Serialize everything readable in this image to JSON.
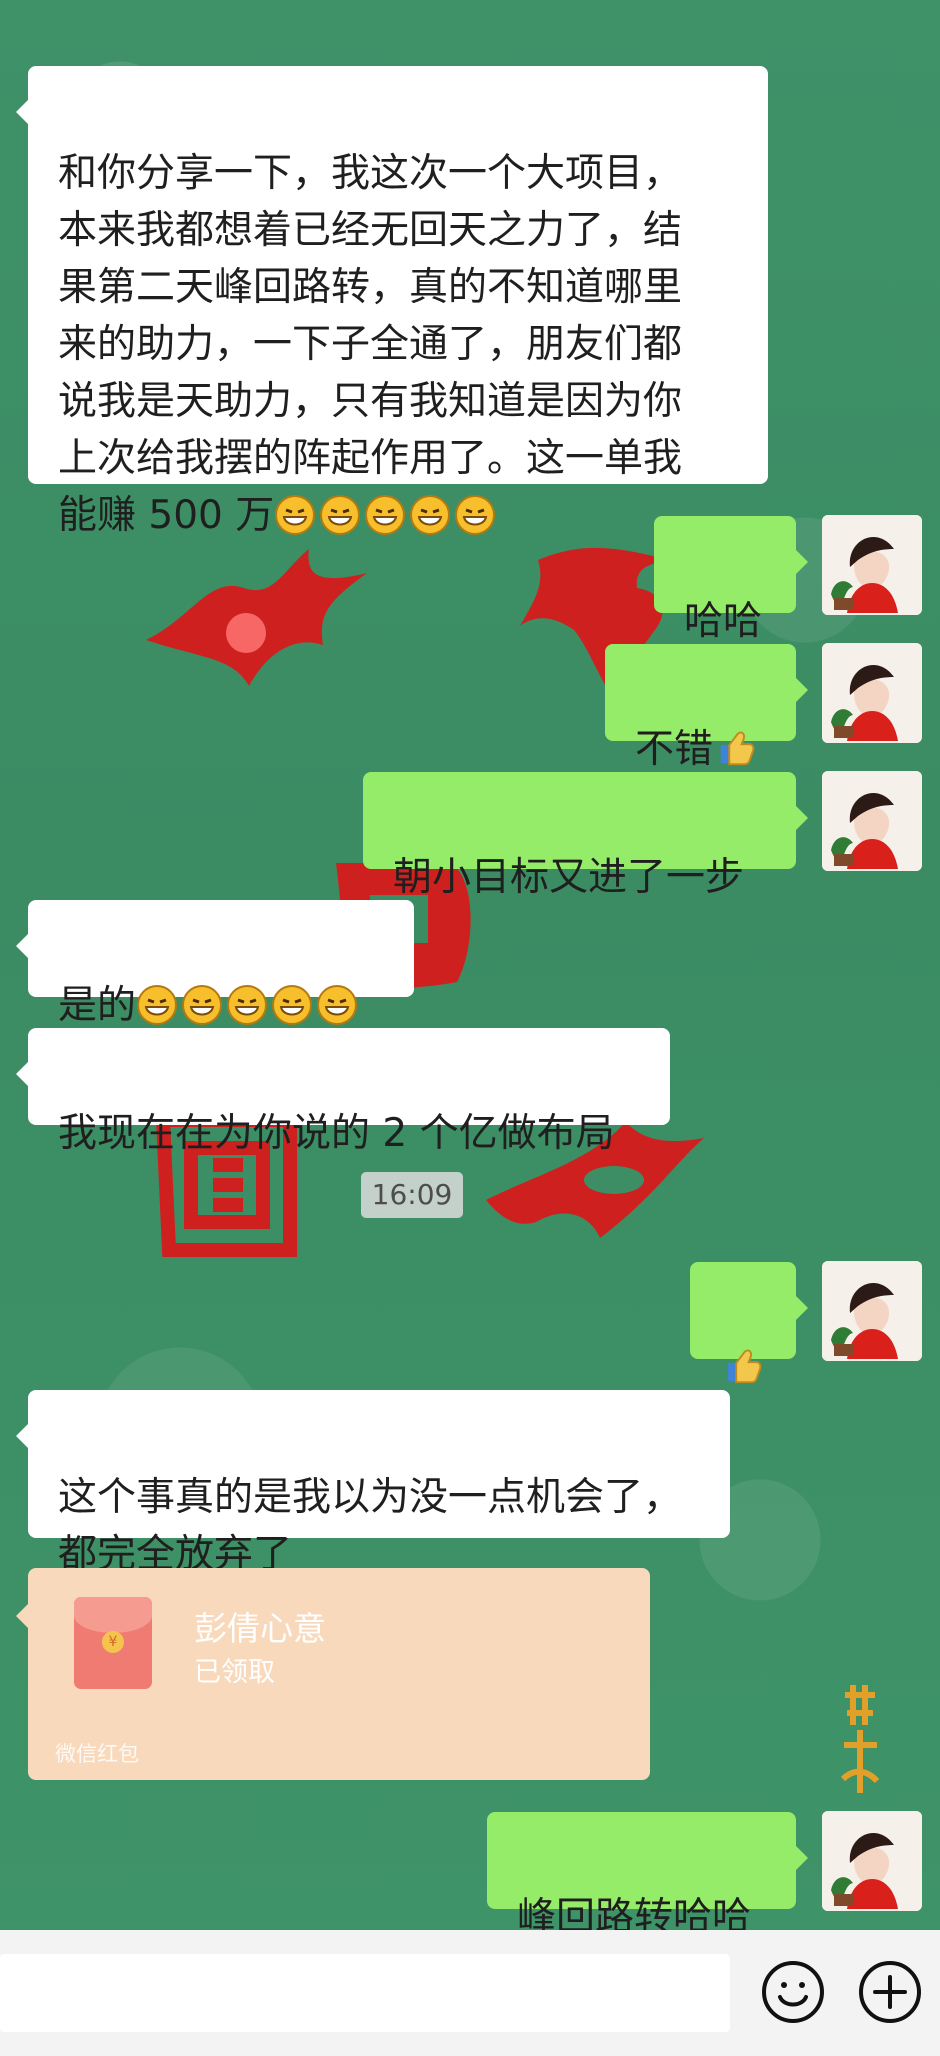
{
  "messages": [
    {
      "text": "和你分享一下，我这次一个大项目，\n本来我都想着已经无回天之力了，结\n果第二天峰回路转，真的不知道哪里\n来的助力，一下子全通了，朋友们都\n说我是天助力，只有我知道是因为你\n上次给我摆的阵起作用了。这一单我\n能赚 500 万"
    },
    {
      "text": "哈哈"
    },
    {
      "text": "不错"
    },
    {
      "text": "朝小目标又进了一步"
    },
    {
      "text": "是的"
    },
    {
      "text": "我现在在为你说的 2 个亿做布局"
    },
    {
      "text": "16:09"
    },
    {
      "text": "这个事真的是我以为没一点机会了，\n都完全放弃了"
    },
    {
      "text": "峰回路转哈哈"
    }
  ],
  "red_packet": {
    "title": "彭倩心意",
    "status": "已领取",
    "footer": "微信红包"
  },
  "icons": {
    "emoji": "grinning-face-icon",
    "thumbs_up": "thumbs-up-icon",
    "bottom_emoji": "emoji-button-icon",
    "plus": "plus-icon"
  }
}
